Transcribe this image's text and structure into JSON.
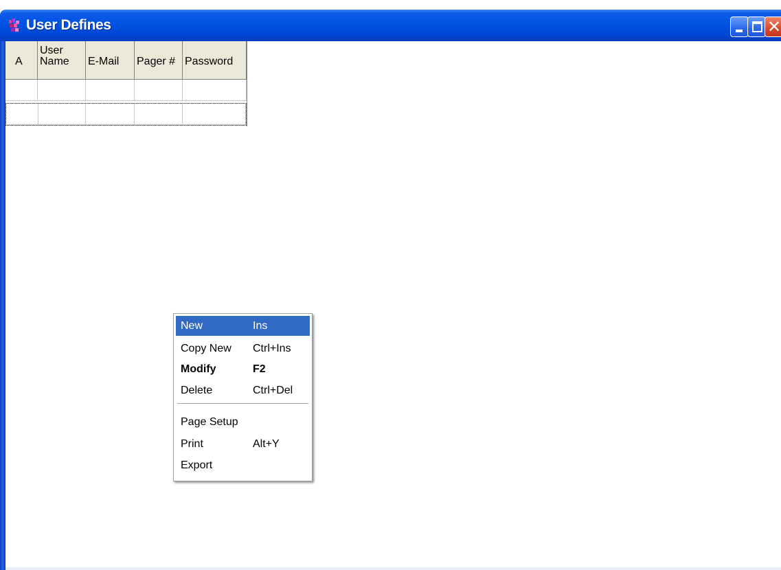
{
  "window": {
    "title": "User Defines"
  },
  "grid": {
    "columns": [
      "A",
      "User\nName",
      "E-Mail",
      "Pager #",
      "Password"
    ],
    "rows": [
      [
        "",
        "",
        "",
        "",
        ""
      ],
      [
        "",
        "",
        "",
        "",
        ""
      ]
    ]
  },
  "context_menu": {
    "items": [
      {
        "label": "New",
        "shortcut": "Ins"
      },
      {
        "label": "Copy New",
        "shortcut": "Ctrl+Ins"
      },
      {
        "label": "Modify",
        "shortcut": "F2"
      },
      {
        "label": "Delete",
        "shortcut": "Ctrl+Del"
      },
      {
        "label": "Page Setup",
        "shortcut": ""
      },
      {
        "label": "Print",
        "shortcut": "Alt+Y"
      },
      {
        "label": "Export",
        "shortcut": ""
      }
    ],
    "selected_item": "New",
    "default_item": "Modify"
  },
  "colors": {
    "titlebar": "#0053e2",
    "menu_highlight": "#316ac5",
    "close_button": "#d8472a"
  },
  "icons": {
    "app": "app-icon",
    "minimize": "minimize-icon",
    "maximize": "maximize-icon",
    "close": "close-icon"
  }
}
